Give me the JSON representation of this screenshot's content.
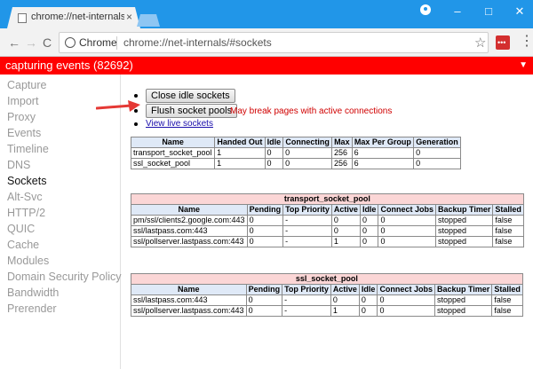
{
  "window": {
    "tab_title": "chrome://net-internals/#",
    "tab_close": "×",
    "minimize": "–",
    "maximize": "□",
    "close": "✕"
  },
  "toolbar": {
    "back": "←",
    "forward": "→",
    "reload": "C",
    "site_chip": "Chrome",
    "url": "chrome://net-internals/#sockets",
    "star": "☆",
    "menu": "⋮"
  },
  "banner": {
    "text": "capturing events (82692)",
    "arrow": "▼"
  },
  "sidebar": {
    "items": [
      {
        "label": "Capture"
      },
      {
        "label": "Import"
      },
      {
        "label": "Proxy"
      },
      {
        "label": "Events"
      },
      {
        "label": "Timeline"
      },
      {
        "label": "DNS"
      },
      {
        "label": "Sockets",
        "active": true
      },
      {
        "label": "Alt-Svc"
      },
      {
        "label": "HTTP/2"
      },
      {
        "label": "QUIC"
      },
      {
        "label": "Cache"
      },
      {
        "label": "Modules"
      },
      {
        "label": "Domain Security Policy"
      },
      {
        "label": "Bandwidth"
      },
      {
        "label": "Prerender"
      }
    ]
  },
  "sockets": {
    "close_idle_label": "Close idle sockets",
    "flush_label": "Flush socket pools",
    "flush_warning": "May break pages with active connections",
    "view_live_link": "View live sockets"
  },
  "pools_table": {
    "headers": [
      "Name",
      "Handed Out",
      "Idle",
      "Connecting",
      "Max",
      "Max Per Group",
      "Generation"
    ],
    "rows": [
      [
        "transport_socket_pool",
        "1",
        "0",
        "0",
        "256",
        "6",
        "0"
      ],
      [
        "ssl_socket_pool",
        "1",
        "0",
        "0",
        "256",
        "6",
        "0"
      ]
    ]
  },
  "transport_table": {
    "caption": "transport_socket_pool",
    "headers": [
      "Name",
      "Pending",
      "Top Priority",
      "Active",
      "Idle",
      "Connect Jobs",
      "Backup Timer",
      "Stalled"
    ],
    "rows": [
      [
        "pm/ssl/clients2.google.com:443",
        "0",
        "-",
        "0",
        "0",
        "0",
        "stopped",
        "false"
      ],
      [
        "ssl/lastpass.com:443",
        "0",
        "-",
        "0",
        "0",
        "0",
        "stopped",
        "false"
      ],
      [
        "ssl/pollserver.lastpass.com:443",
        "0",
        "-",
        "1",
        "0",
        "0",
        "stopped",
        "false"
      ]
    ]
  },
  "ssl_table": {
    "caption": "ssl_socket_pool",
    "headers": [
      "Name",
      "Pending",
      "Top Priority",
      "Active",
      "Idle",
      "Connect Jobs",
      "Backup Timer",
      "Stalled"
    ],
    "rows": [
      [
        "ssl/lastpass.com:443",
        "0",
        "-",
        "0",
        "0",
        "0",
        "stopped",
        "false"
      ],
      [
        "ssl/pollserver.lastpass.com:443",
        "0",
        "-",
        "1",
        "0",
        "0",
        "stopped",
        "false"
      ]
    ]
  },
  "colors": {
    "titlebar": "#2196e8",
    "banner": "#ff0000",
    "table_header": "#dfe9f7",
    "caption_header": "#fbd6d6",
    "arrow": "#e53935"
  }
}
